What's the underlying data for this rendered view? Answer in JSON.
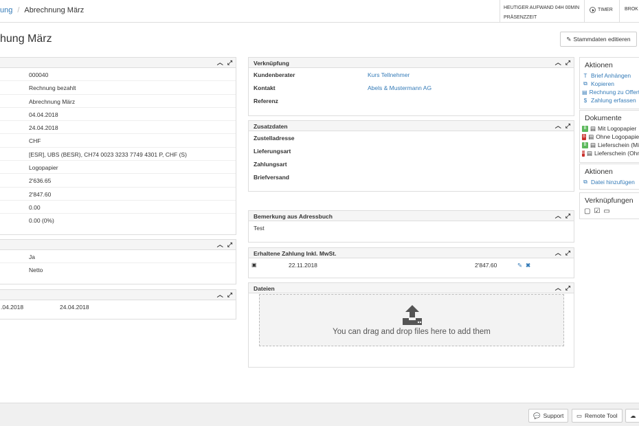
{
  "breadcrumb": {
    "parent": "ung",
    "separator": "/",
    "current": "Abrechnung März"
  },
  "effort": {
    "line1": "HEUTIGER AUFWAND 04H 00MIN",
    "line2": "PRÄSENZZEIT"
  },
  "timer_label": "TIMER",
  "broker_label": "BROK",
  "page_title": "hung März",
  "edit_button": "Stammdaten editieren",
  "main_panel": {
    "values": [
      "000040",
      "Rechnung bezahlt",
      "Abrechnung März",
      "04.04.2018",
      "24.04.2018",
      "CHF",
      "[ESR], UBS (BESR), CH74 0023 3233 7749 4301 P, CHF (S)",
      "Logopapier",
      "2'636.65",
      "2'847.60",
      "0.00",
      "0.00 (0%)"
    ]
  },
  "options_panel": {
    "values": [
      "Ja",
      "Netto"
    ]
  },
  "dates_panel": {
    "date1": ".04.2018",
    "date2": "24.04.2018"
  },
  "verknuepfung": {
    "title": "Verknüpfung",
    "rows": [
      {
        "label": "Kundenberater",
        "value": "Kurs Tellnehmer"
      },
      {
        "label": "Kontakt",
        "value": "Abels & Mustermann AG"
      },
      {
        "label": "Referenz",
        "value": ""
      }
    ]
  },
  "zusatzdaten": {
    "title": "Zusatzdaten",
    "labels": [
      "Zustelladresse",
      "Lieferungsart",
      "Zahlungsart",
      "Briefversand"
    ]
  },
  "bemerkung": {
    "title": "Bemerkung aus Adressbuch",
    "text": "Test"
  },
  "zahlung": {
    "title": "Erhaltene Zahlung Inkl. MwSt.",
    "date": "22.11.2018",
    "amount": "2'847.60"
  },
  "dateien": {
    "title": "Dateien",
    "drop_text": "You can drag and drop files here to add them"
  },
  "sidebar": {
    "aktionen1": {
      "title": "Aktionen",
      "items": [
        "Brief Anhängen",
        "Kopieren",
        "Rechnung zu Offerte",
        "Zahlung erfassen"
      ]
    },
    "dokumente": {
      "title": "Dokumente",
      "items": [
        "Mit Logopapier",
        "Ohne Logopapier",
        "Lieferschein (Mit",
        "Lieferschein (Ohne"
      ]
    },
    "aktionen2": {
      "title": "Aktionen",
      "items": [
        "Datei hinzufügen"
      ]
    },
    "verknuepfungen": {
      "title": "Verknüpfungen"
    }
  },
  "footer": {
    "support": "Support",
    "remote": "Remote Tool"
  },
  "colors": {
    "link": "#337ab7",
    "panel_head": "#f5f5f5",
    "pdf_green": "#5cb85c",
    "pdf_red": "#c9302c"
  }
}
